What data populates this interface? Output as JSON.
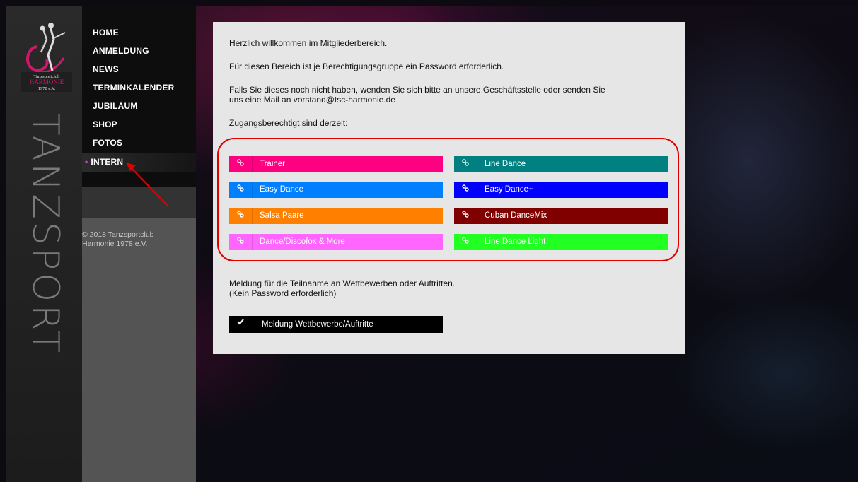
{
  "brand": {
    "logo_lines": [
      "Tanzsportclub",
      "HARMONIE",
      "1978 e.V."
    ],
    "vertical_word": "TANZSPORT"
  },
  "nav": {
    "items": [
      {
        "label": "HOME"
      },
      {
        "label": "ANMELDUNG"
      },
      {
        "label": "NEWS"
      },
      {
        "label": "TERMINKALENDER"
      },
      {
        "label": "JUBILÄUM"
      },
      {
        "label": "SHOP"
      },
      {
        "label": "FOTOS"
      },
      {
        "label": "INTERN",
        "active": true
      }
    ],
    "active_marker": "•"
  },
  "copyright": {
    "line1": "© 2018 Tanzsportclub",
    "line2": "Harmonie 1978 e.V."
  },
  "main": {
    "intro": "Herzlich willkommen im Mitgliederbereich.",
    "password_info": "Für diesen Bereich ist je Berechtigungsgruppe ein Password erforderlich.",
    "contact_line1": "Falls Sie dieses noch nicht haben, wenden Sie sich bitte an unsere Geschäftsstelle oder senden Sie",
    "contact_line2": "uns eine Mail an vorstand@tsc-harmonie.de",
    "access_heading": "Zugangsberechtigt sind derzeit:",
    "groups": [
      {
        "label": "Trainer",
        "color": "#ff0080"
      },
      {
        "label": "Line Dance",
        "color": "#008080"
      },
      {
        "label": "Easy Dance",
        "color": "#0080ff"
      },
      {
        "label": "Easy Dance+",
        "color": "#0000ff"
      },
      {
        "label": "Salsa Paare",
        "color": "#ff8000"
      },
      {
        "label": "Cuban DanceMix",
        "color": "#800000"
      },
      {
        "label": "Dance/Discofox & More",
        "color": "#ff66ff"
      },
      {
        "label": "Line Dance Light",
        "color": "#22ff22"
      }
    ],
    "group_icon": "link-icon",
    "competition_line1": "Meldung für die Teilnahme an Wettbewerben oder Auftritten.",
    "competition_line2": "(Kein Password erforderlich)",
    "competition_button": "Meldung Wettbewerbe/Auftritte",
    "competition_icon": "check-icon"
  },
  "annotation": {
    "highlight_color": "#e00000"
  }
}
